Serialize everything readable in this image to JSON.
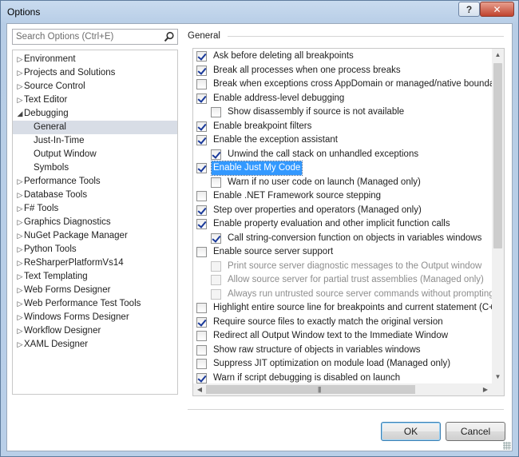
{
  "window": {
    "title": "Options",
    "help_label": "?",
    "close_label": "✕"
  },
  "search": {
    "placeholder": "Search Options (Ctrl+E)"
  },
  "tree": [
    {
      "label": "Environment",
      "expandable": true
    },
    {
      "label": "Projects and Solutions",
      "expandable": true
    },
    {
      "label": "Source Control",
      "expandable": true
    },
    {
      "label": "Text Editor",
      "expandable": true
    },
    {
      "label": "Debugging",
      "expandable": true,
      "expanded": true
    },
    {
      "label": "General",
      "child": true,
      "selected": true
    },
    {
      "label": "Just-In-Time",
      "child": true
    },
    {
      "label": "Output Window",
      "child": true
    },
    {
      "label": "Symbols",
      "child": true
    },
    {
      "label": "Performance Tools",
      "expandable": true
    },
    {
      "label": "Database Tools",
      "expandable": true
    },
    {
      "label": "F# Tools",
      "expandable": true
    },
    {
      "label": "Graphics Diagnostics",
      "expandable": true
    },
    {
      "label": "NuGet Package Manager",
      "expandable": true
    },
    {
      "label": "Python Tools",
      "expandable": true
    },
    {
      "label": "ReSharperPlatformVs14",
      "expandable": true
    },
    {
      "label": "Text Templating",
      "expandable": true
    },
    {
      "label": "Web Forms Designer",
      "expandable": true
    },
    {
      "label": "Web Performance Test Tools",
      "expandable": true
    },
    {
      "label": "Windows Forms Designer",
      "expandable": true
    },
    {
      "label": "Workflow Designer",
      "expandable": true
    },
    {
      "label": "XAML Designer",
      "expandable": true
    }
  ],
  "general": {
    "group_label": "General",
    "options": [
      {
        "label": "Ask before deleting all breakpoints",
        "checked": true,
        "indent": 0
      },
      {
        "label": "Break all processes when one process breaks",
        "checked": true,
        "indent": 0
      },
      {
        "label": "Break when exceptions cross AppDomain or managed/native boundaries",
        "checked": false,
        "indent": 0
      },
      {
        "label": "Enable address-level debugging",
        "checked": true,
        "indent": 0
      },
      {
        "label": "Show disassembly if source is not available",
        "checked": false,
        "indent": 1
      },
      {
        "label": "Enable breakpoint filters",
        "checked": true,
        "indent": 0
      },
      {
        "label": "Enable the exception assistant",
        "checked": true,
        "indent": 0
      },
      {
        "label": "Unwind the call stack on unhandled exceptions",
        "checked": true,
        "indent": 1
      },
      {
        "label": "Enable Just My Code",
        "checked": true,
        "indent": 0,
        "highlighted": true
      },
      {
        "label": "Warn if no user code on launch (Managed only)",
        "checked": false,
        "indent": 1
      },
      {
        "label": "Enable .NET Framework source stepping",
        "checked": false,
        "indent": 0
      },
      {
        "label": "Step over properties and operators (Managed only)",
        "checked": true,
        "indent": 0
      },
      {
        "label": "Enable property evaluation and other implicit function calls",
        "checked": true,
        "indent": 0
      },
      {
        "label": "Call string-conversion function on objects in variables windows",
        "checked": true,
        "indent": 1
      },
      {
        "label": "Enable source server support",
        "checked": false,
        "indent": 0
      },
      {
        "label": "Print source server diagnostic messages to the Output window",
        "checked": false,
        "indent": 1,
        "disabled": true
      },
      {
        "label": "Allow source server for partial trust assemblies (Managed only)",
        "checked": false,
        "indent": 1,
        "disabled": true
      },
      {
        "label": "Always run untrusted source server commands without prompting",
        "checked": false,
        "indent": 1,
        "disabled": true
      },
      {
        "label": "Highlight entire source line for breakpoints and current statement (C++ only)",
        "checked": false,
        "indent": 0
      },
      {
        "label": "Require source files to exactly match the original version",
        "checked": true,
        "indent": 0
      },
      {
        "label": "Redirect all Output Window text to the Immediate Window",
        "checked": false,
        "indent": 0
      },
      {
        "label": "Show raw structure of objects in variables windows",
        "checked": false,
        "indent": 0
      },
      {
        "label": "Suppress JIT optimization on module load (Managed only)",
        "checked": false,
        "indent": 0
      },
      {
        "label": "Warn if script debugging is disabled on launch",
        "checked": true,
        "indent": 0
      }
    ]
  },
  "buttons": {
    "ok": "OK",
    "cancel": "Cancel"
  }
}
